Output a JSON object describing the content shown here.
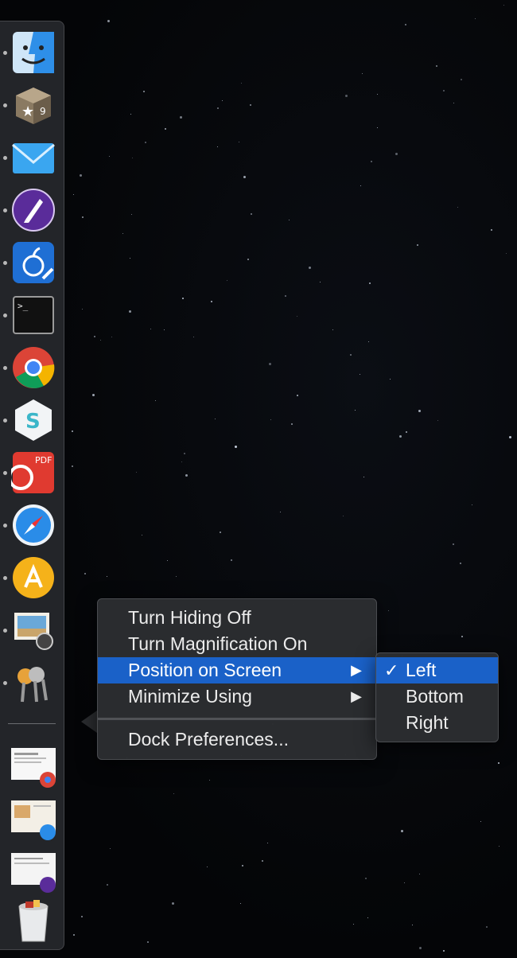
{
  "dock": {
    "apps": [
      {
        "name": "Finder",
        "icon": "finder-icon",
        "running": true
      },
      {
        "name": "OmniFocus",
        "icon": "omnifocus-box-icon",
        "running": true
      },
      {
        "name": "Mail",
        "icon": "mail-icon",
        "running": true
      },
      {
        "name": "Quill",
        "icon": "quill-icon",
        "running": true
      },
      {
        "name": "Keynote Edit",
        "icon": "apple-edit-icon",
        "running": true
      },
      {
        "name": "Terminal",
        "icon": "terminal-icon",
        "running": true
      },
      {
        "name": "Chrome",
        "icon": "chrome-icon",
        "running": true
      },
      {
        "name": "Simplenote",
        "icon": "s-hexagon-icon",
        "running": true
      },
      {
        "name": "PDF Expert",
        "icon": "pdf-icon",
        "running": true
      },
      {
        "name": "Safari",
        "icon": "safari-icon",
        "running": true
      },
      {
        "name": "Instruments",
        "icon": "instruments-icon",
        "running": true
      },
      {
        "name": "Preview",
        "icon": "preview-icon",
        "running": true
      },
      {
        "name": "Keychain",
        "icon": "keychain-icon",
        "running": true
      }
    ],
    "windows": [
      {
        "name": "Chrome window",
        "icon": "chrome-window-thumbnail-icon"
      },
      {
        "name": "Safari window",
        "icon": "safari-window-thumbnail-icon"
      },
      {
        "name": "Quill window",
        "icon": "quill-window-thumbnail-icon"
      }
    ],
    "trash": {
      "name": "Trash",
      "icon": "trash-icon"
    }
  },
  "context_menu": {
    "items": [
      {
        "label": "Turn Hiding Off"
      },
      {
        "label": "Turn Magnification On"
      },
      {
        "label": "Position on Screen",
        "has_submenu": true,
        "arrow": "▶"
      },
      {
        "label": "Minimize Using",
        "has_submenu": true,
        "arrow": "▶"
      }
    ],
    "footer_item": {
      "label": "Dock Preferences..."
    }
  },
  "position_submenu": {
    "items": [
      {
        "label": "Left",
        "checked": true,
        "check": "✓"
      },
      {
        "label": "Bottom"
      },
      {
        "label": "Right"
      }
    ]
  },
  "colors": {
    "highlight": "#1a61c8",
    "menu_bg": "#2b2d31"
  }
}
